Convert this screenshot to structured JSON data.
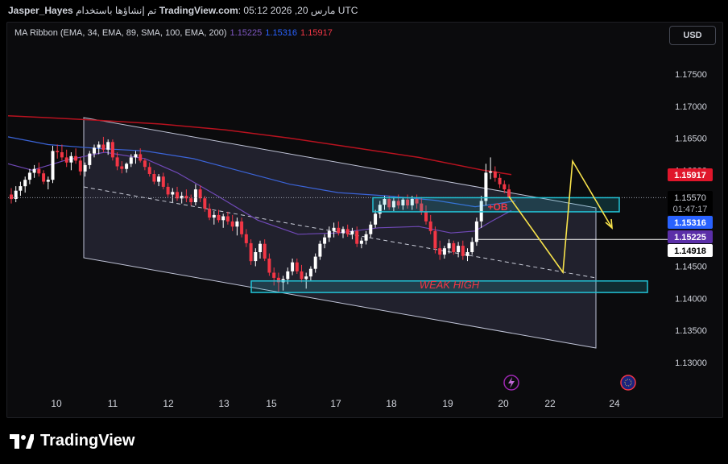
{
  "header": {
    "author": "Jasper_Hayes",
    "published_text": "تم إنشاؤها باستخدام",
    "site": "TradingView.com",
    "timestamp": "05:12 2026 ,20 مارس UTC"
  },
  "legend": {
    "label": "MA Ribbon (EMA, 34, EMA, 89, SMA, 100, EMA, 200)",
    "values": [
      "1.15225",
      "1.15316",
      "1.15917"
    ]
  },
  "currency_button": "USD",
  "price_tags": {
    "ma_red": "1.15917",
    "last_price": "1.15570",
    "countdown": "01:47:17",
    "ma_blue": "1.15316",
    "ma_purple": "1.15225",
    "line_level": "1.14918"
  },
  "annotations": {
    "ob_label": "+OB",
    "weak_high_label": "WEAK HIGH"
  },
  "colors": {
    "up": "#ffffff",
    "down": "#f23645",
    "ma_red": "#b8121f",
    "ma_blue": "#3b64d8",
    "ma_purple": "#7049b8",
    "zone": "#22c3d6",
    "projection": "#f7e24b",
    "channel_fill": "#242431"
  },
  "brand": "TradingView",
  "icons": [
    "lightning-icon",
    "globe-icon"
  ],
  "chart_data": {
    "type": "candlestick",
    "symbol_hint": "EURUSD",
    "x_ticks": [
      "10",
      "11",
      "12",
      "13",
      "15",
      "17",
      "18",
      "19",
      "20",
      "22",
      "24"
    ],
    "y_ticks": [
      "1.17500",
      "1.17000",
      "1.16500",
      "1.16000",
      "1.15500",
      "1.15000",
      "1.14500",
      "1.14000",
      "1.13500",
      "1.13000"
    ],
    "ylim": [
      1.1265,
      1.1795
    ],
    "candles": [
      [
        1.1562,
        1.1572,
        1.1548,
        1.1555
      ],
      [
        1.1555,
        1.1575,
        1.155,
        1.1568
      ],
      [
        1.1568,
        1.1582,
        1.156,
        1.1575
      ],
      [
        1.1575,
        1.159,
        1.1565,
        1.1585
      ],
      [
        1.1585,
        1.1602,
        1.1578,
        1.1596
      ],
      [
        1.1596,
        1.1608,
        1.1588,
        1.1602
      ],
      [
        1.1602,
        1.1612,
        1.159,
        1.1595
      ],
      [
        1.1595,
        1.16,
        1.1578,
        1.1582
      ],
      [
        1.1582,
        1.159,
        1.157,
        1.1585
      ],
      [
        1.1585,
        1.1638,
        1.158,
        1.163
      ],
      [
        1.163,
        1.164,
        1.1618,
        1.1628
      ],
      [
        1.1628,
        1.164,
        1.1615,
        1.162
      ],
      [
        1.162,
        1.1632,
        1.1605,
        1.1612
      ],
      [
        1.1612,
        1.1628,
        1.16,
        1.1622
      ],
      [
        1.1622,
        1.1634,
        1.161,
        1.1615
      ],
      [
        1.1615,
        1.162,
        1.1592,
        1.1598
      ],
      [
        1.1598,
        1.1612,
        1.159,
        1.1608
      ],
      [
        1.1608,
        1.163,
        1.1602,
        1.1626
      ],
      [
        1.1626,
        1.164,
        1.162,
        1.1635
      ],
      [
        1.1635,
        1.1645,
        1.1625,
        1.164
      ],
      [
        1.164,
        1.1652,
        1.1628,
        1.1632
      ],
      [
        1.1632,
        1.1648,
        1.1624,
        1.1644
      ],
      [
        1.1644,
        1.1648,
        1.1615,
        1.162
      ],
      [
        1.162,
        1.1628,
        1.16,
        1.1606
      ],
      [
        1.1606,
        1.1614,
        1.1595,
        1.1602
      ],
      [
        1.1602,
        1.1612,
        1.1596,
        1.161
      ],
      [
        1.161,
        1.1625,
        1.1605,
        1.162
      ],
      [
        1.162,
        1.163,
        1.161,
        1.1625
      ],
      [
        1.1625,
        1.1634,
        1.1612,
        1.1615
      ],
      [
        1.1615,
        1.1618,
        1.16,
        1.1605
      ],
      [
        1.1605,
        1.1612,
        1.159,
        1.1594
      ],
      [
        1.1594,
        1.16,
        1.1578,
        1.1582
      ],
      [
        1.1582,
        1.1594,
        1.1575,
        1.159
      ],
      [
        1.159,
        1.1596,
        1.157,
        1.1574
      ],
      [
        1.1574,
        1.158,
        1.1558,
        1.1562
      ],
      [
        1.1562,
        1.1572,
        1.155,
        1.1566
      ],
      [
        1.1566,
        1.1574,
        1.1552,
        1.1556
      ],
      [
        1.1556,
        1.1566,
        1.1548,
        1.156
      ],
      [
        1.156,
        1.157,
        1.155,
        1.1556
      ],
      [
        1.1556,
        1.1562,
        1.1545,
        1.155
      ],
      [
        1.155,
        1.1578,
        1.1545,
        1.157
      ],
      [
        1.157,
        1.1576,
        1.155,
        1.1556
      ],
      [
        1.1556,
        1.156,
        1.1535,
        1.154
      ],
      [
        1.154,
        1.1548,
        1.1522,
        1.1526
      ],
      [
        1.1526,
        1.1536,
        1.1515,
        1.153
      ],
      [
        1.153,
        1.1538,
        1.1518,
        1.1522
      ],
      [
        1.1522,
        1.1532,
        1.151,
        1.1528
      ],
      [
        1.1528,
        1.1535,
        1.1515,
        1.152
      ],
      [
        1.152,
        1.153,
        1.1505,
        1.1512
      ],
      [
        1.1512,
        1.1526,
        1.1498,
        1.152
      ],
      [
        1.152,
        1.1526,
        1.1495,
        1.15
      ],
      [
        1.15,
        1.1508,
        1.148,
        1.1486
      ],
      [
        1.1486,
        1.1492,
        1.1452,
        1.1458
      ],
      [
        1.1458,
        1.1478,
        1.145,
        1.1472
      ],
      [
        1.1472,
        1.149,
        1.1462,
        1.1485
      ],
      [
        1.1485,
        1.1492,
        1.1458,
        1.1462
      ],
      [
        1.1462,
        1.147,
        1.1435,
        1.144
      ],
      [
        1.144,
        1.1448,
        1.142,
        1.1432
      ],
      [
        1.1432,
        1.144,
        1.141,
        1.1425
      ],
      [
        1.1425,
        1.1435,
        1.1412,
        1.143
      ],
      [
        1.143,
        1.1448,
        1.1422,
        1.1442
      ],
      [
        1.1442,
        1.1462,
        1.1436,
        1.1456
      ],
      [
        1.1456,
        1.1462,
        1.1438,
        1.1442
      ],
      [
        1.1442,
        1.1452,
        1.1425,
        1.143
      ],
      [
        1.143,
        1.144,
        1.1415,
        1.1434
      ],
      [
        1.1434,
        1.145,
        1.1428,
        1.1446
      ],
      [
        1.1446,
        1.147,
        1.144,
        1.1465
      ],
      [
        1.1465,
        1.149,
        1.146,
        1.1485
      ],
      [
        1.1485,
        1.15,
        1.1478,
        1.1495
      ],
      [
        1.1495,
        1.1512,
        1.1488,
        1.1505
      ],
      [
        1.1505,
        1.1518,
        1.1495,
        1.151
      ],
      [
        1.151,
        1.152,
        1.1498,
        1.1502
      ],
      [
        1.1502,
        1.1512,
        1.1494,
        1.1508
      ],
      [
        1.1508,
        1.1515,
        1.1496,
        1.15
      ],
      [
        1.15,
        1.151,
        1.1492,
        1.1505
      ],
      [
        1.1505,
        1.1512,
        1.148,
        1.1485
      ],
      [
        1.1485,
        1.1495,
        1.1478,
        1.149
      ],
      [
        1.149,
        1.1505,
        1.1484,
        1.15
      ],
      [
        1.15,
        1.152,
        1.1495,
        1.1515
      ],
      [
        1.1515,
        1.1538,
        1.151,
        1.1532
      ],
      [
        1.1532,
        1.1552,
        1.1525,
        1.1546
      ],
      [
        1.1546,
        1.156,
        1.1538,
        1.1555
      ],
      [
        1.1555,
        1.156,
        1.1538,
        1.1542
      ],
      [
        1.1542,
        1.1558,
        1.1536,
        1.1552
      ],
      [
        1.1552,
        1.1562,
        1.154,
        1.1545
      ],
      [
        1.1545,
        1.1558,
        1.1538,
        1.1554
      ],
      [
        1.1554,
        1.1562,
        1.154,
        1.1545
      ],
      [
        1.1545,
        1.156,
        1.1538,
        1.1555
      ],
      [
        1.1555,
        1.1562,
        1.154,
        1.1548
      ],
      [
        1.1548,
        1.1558,
        1.153,
        1.1535
      ],
      [
        1.1535,
        1.1545,
        1.1515,
        1.152
      ],
      [
        1.152,
        1.153,
        1.15,
        1.1505
      ],
      [
        1.1505,
        1.1512,
        1.147,
        1.1478
      ],
      [
        1.1478,
        1.149,
        1.146,
        1.1468
      ],
      [
        1.1468,
        1.1482,
        1.1462,
        1.1478
      ],
      [
        1.1478,
        1.1492,
        1.147,
        1.1486
      ],
      [
        1.1486,
        1.149,
        1.1468,
        1.1472
      ],
      [
        1.1472,
        1.1488,
        1.1464,
        1.1482
      ],
      [
        1.1482,
        1.149,
        1.146,
        1.1466
      ],
      [
        1.1466,
        1.1478,
        1.1458,
        1.1472
      ],
      [
        1.1472,
        1.1495,
        1.1468,
        1.1488
      ],
      [
        1.1488,
        1.1526,
        1.1482,
        1.152
      ],
      [
        1.152,
        1.156,
        1.151,
        1.1552
      ],
      [
        1.1552,
        1.161,
        1.1545,
        1.1596
      ],
      [
        1.1596,
        1.162,
        1.1586,
        1.1598
      ],
      [
        1.1598,
        1.1606,
        1.1582,
        1.1588
      ],
      [
        1.1588,
        1.1594,
        1.1572,
        1.1578
      ],
      [
        1.1578,
        1.1584,
        1.1564,
        1.157
      ],
      [
        1.157,
        1.1578,
        1.1562,
        1.1557
      ]
    ],
    "ma_series_values": {
      "purple": "1.15225",
      "blue": "1.15316",
      "red": "1.15917"
    },
    "levels": {
      "ob_zone": [
        1.1535,
        1.1557
      ],
      "weak_high_zone": [
        1.1409,
        1.1427
      ],
      "horizontal_line": 1.14918,
      "last_price": 1.1557
    },
    "projection": [
      [
        1.1557
      ],
      [
        1.144
      ],
      [
        1.1615
      ],
      [
        1.149
      ]
    ]
  }
}
